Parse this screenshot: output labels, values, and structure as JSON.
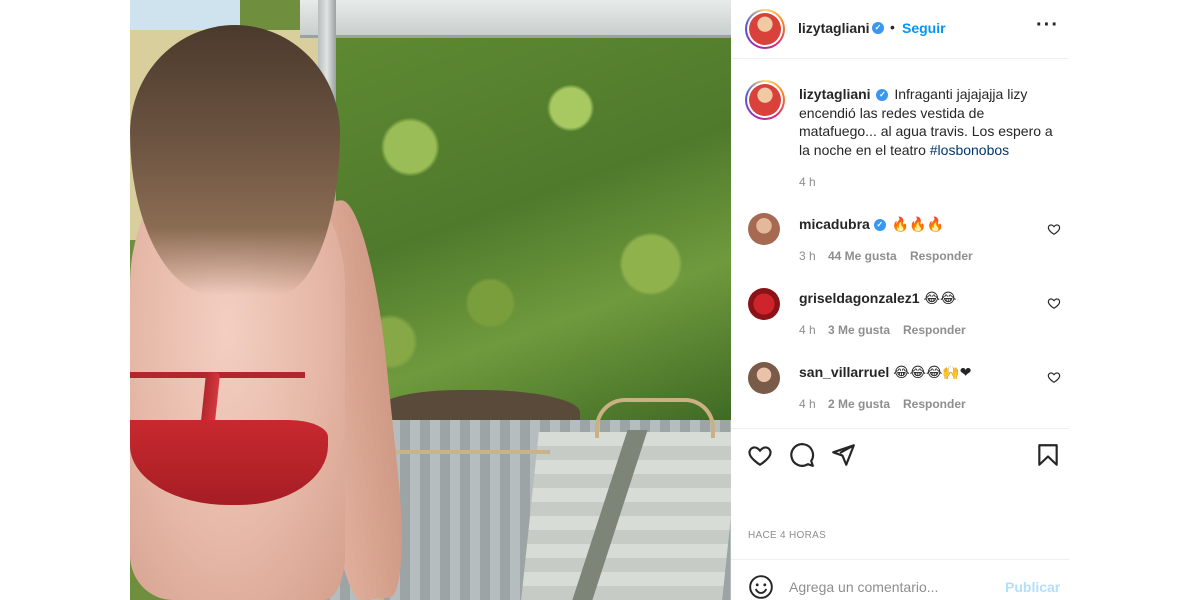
{
  "post": {
    "author": "lizytagliani",
    "verified": true,
    "follow_label": "Seguir",
    "more_icon": "more-horizontal-icon",
    "photo_description_colors": {
      "bikini": "#c8292f",
      "hedge": "#5f8a32"
    }
  },
  "caption": {
    "author": "lizytagliani",
    "text": "Infraganti jajajajja lizy encendió las redes vestida de matafuego... al agua travis. Los espero a la noche en el teatro ",
    "hashtag": "#losbonobos",
    "age": "4 h"
  },
  "comments": [
    {
      "user": "micadubra",
      "verified": true,
      "text": "🔥🔥🔥",
      "age": "3 h",
      "likes": "44 Me gusta",
      "reply": "Responder"
    },
    {
      "user": "griseldagonzalez1",
      "verified": false,
      "text": "😂😂",
      "age": "4 h",
      "likes": "3 Me gusta",
      "reply": "Responder"
    },
    {
      "user": "san_villarruel",
      "verified": false,
      "text": "😂😂😂🙌❤",
      "age": "4 h",
      "likes": "2 Me gusta",
      "reply": "Responder"
    }
  ],
  "actions": {
    "timestamp": "HACE 4 HORAS"
  },
  "composer": {
    "placeholder": "Agrega un comentario...",
    "publish_label": "Publicar"
  },
  "colors": {
    "accent": "#0095f6",
    "verified": "#3897f0",
    "muted": "#8e8e8e",
    "publish_disabled": "#b2dffc"
  }
}
